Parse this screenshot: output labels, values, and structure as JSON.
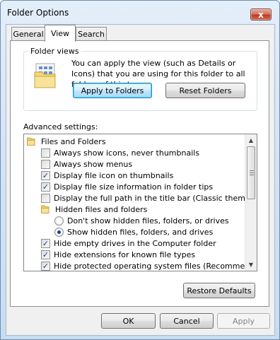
{
  "window": {
    "title": "Folder Options",
    "close_glyph": "x"
  },
  "tabs": [
    {
      "label": "General",
      "active": false
    },
    {
      "label": "View",
      "active": true
    },
    {
      "label": "Search",
      "active": false
    }
  ],
  "folder_views": {
    "label": "Folder views",
    "description": "You can apply the view (such as Details or Icons) that you are using for this folder to all folders of this type.",
    "apply_label": "Apply to Folders",
    "reset_label": "Reset Folders",
    "icon": "folder-views-icon"
  },
  "advanced": {
    "label": "Advanced settings:",
    "items": [
      {
        "type": "folder",
        "label": "Files and Folders"
      },
      {
        "type": "checkbox",
        "label": "Always show icons, never thumbnails",
        "checked": false
      },
      {
        "type": "checkbox",
        "label": "Always show menus",
        "checked": false
      },
      {
        "type": "checkbox",
        "label": "Display file icon on thumbnails",
        "checked": true
      },
      {
        "type": "checkbox",
        "label": "Display file size information in folder tips",
        "checked": true
      },
      {
        "type": "checkbox",
        "label": "Display the full path in the title bar (Classic theme only)",
        "checked": false
      },
      {
        "type": "folder",
        "label": "Hidden files and folders"
      },
      {
        "type": "radio",
        "label": "Don't show hidden files, folders, or drives",
        "checked": false
      },
      {
        "type": "radio",
        "label": "Show hidden files, folders, and drives",
        "checked": true
      },
      {
        "type": "checkbox",
        "label": "Hide empty drives in the Computer folder",
        "checked": true
      },
      {
        "type": "checkbox",
        "label": "Hide extensions for known file types",
        "checked": true
      },
      {
        "type": "checkbox",
        "label": "Hide protected operating system files (Recommended)",
        "checked": true
      }
    ]
  },
  "buttons": {
    "restore_defaults": "Restore Defaults",
    "ok": "OK",
    "cancel": "Cancel",
    "apply": "Apply"
  },
  "colors": {
    "title_bar": "#d6e5f5",
    "close_red": "#c13b23",
    "check": "#2a3d86"
  }
}
